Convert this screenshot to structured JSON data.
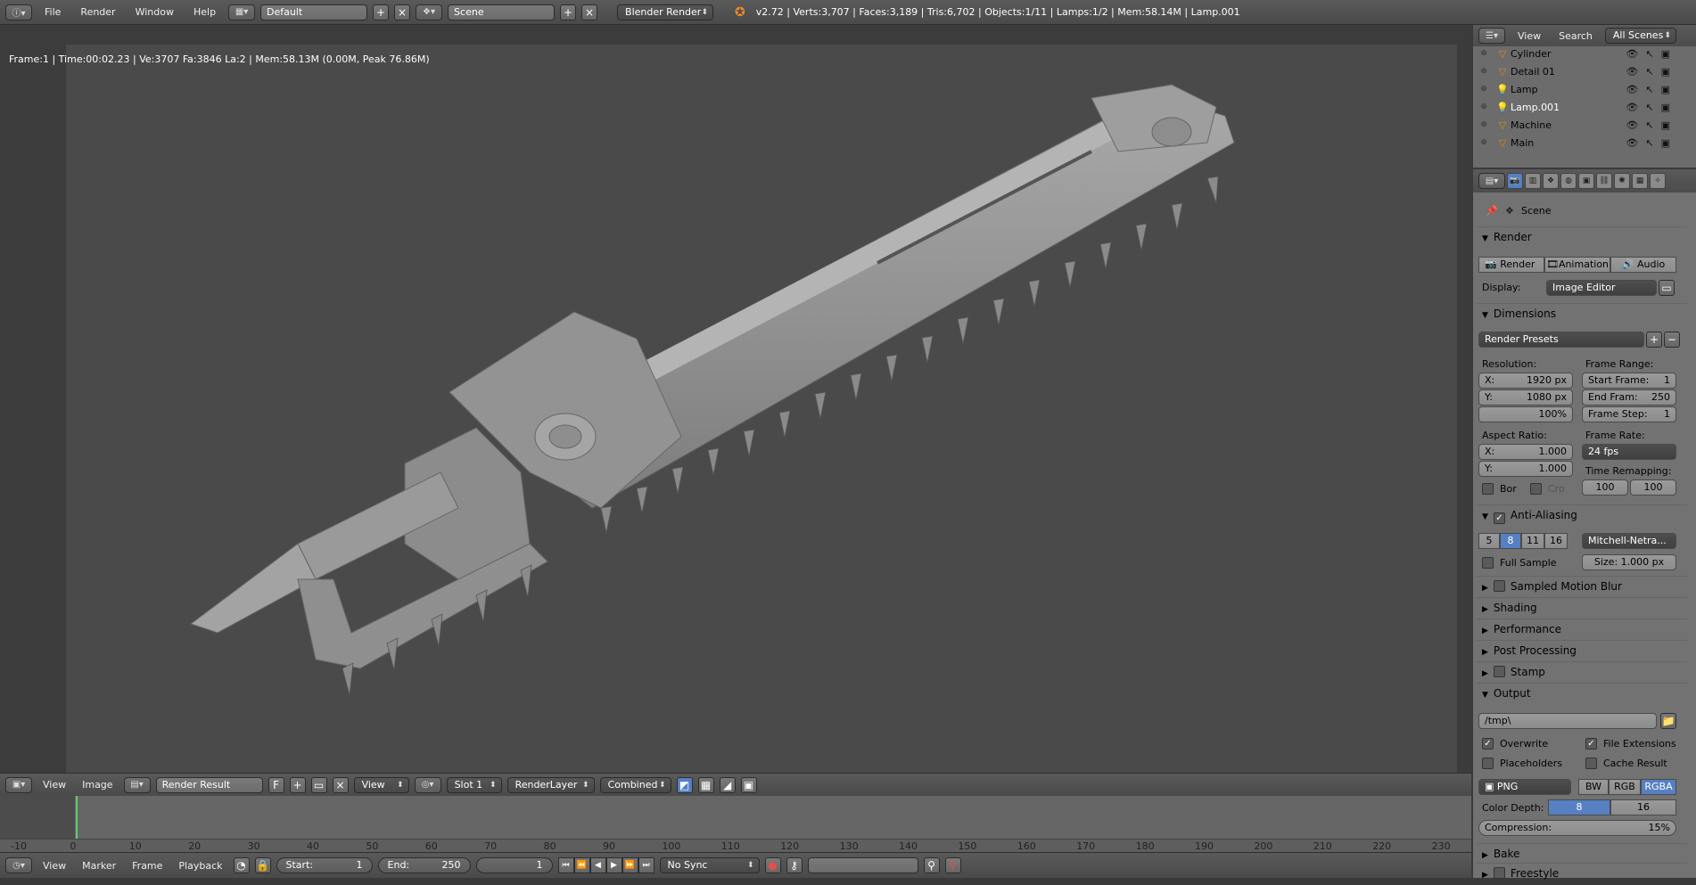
{
  "topbar": {
    "menus": [
      "File",
      "Render",
      "Window",
      "Help"
    ],
    "screen_layout": "Default",
    "scene": "Scene",
    "engine": "Blender Render",
    "stats": "v2.72 | Verts:3,707 | Faces:3,189 | Tris:6,702 | Objects:1/11 | Lamps:1/2 | Mem:58.14M | Lamp.001"
  },
  "viewport": {
    "info": "Frame:1 | Time:00:02.23 | Ve:3707 Fa:3846 La:2 | Mem:58.13M (0.00M, Peak 76.86M)"
  },
  "image_editor_header": {
    "menus": [
      "View",
      "Image"
    ],
    "image_name": "Render Result",
    "fake_user": "F",
    "view_label": "View",
    "slot": "Slot 1",
    "render_layer": "RenderLayer",
    "pass": "Combined"
  },
  "timeline": {
    "ticks": [
      "-10",
      "0",
      "10",
      "20",
      "30",
      "40",
      "50",
      "60",
      "70",
      "80",
      "90",
      "100",
      "110",
      "120",
      "130",
      "140",
      "150",
      "160",
      "170",
      "180",
      "190",
      "200",
      "210",
      "220",
      "230"
    ],
    "current_frame": 1
  },
  "bottombar": {
    "menus": [
      "View",
      "Marker",
      "Frame",
      "Playback"
    ],
    "start_label": "Start:",
    "start_value": "1",
    "end_label": "End:",
    "end_value": "250",
    "current": "1",
    "sync": "No Sync"
  },
  "outliner": {
    "header": [
      "View",
      "Search"
    ],
    "filter": "All Scenes",
    "objects": [
      {
        "name": "Cylinder",
        "icon": "mesh-icon"
      },
      {
        "name": "Detail 01",
        "icon": "mesh-icon"
      },
      {
        "name": "Lamp",
        "icon": "lamp-icon"
      },
      {
        "name": "Lamp.001",
        "icon": "lamp-icon"
      },
      {
        "name": "Machine",
        "icon": "mesh-icon"
      },
      {
        "name": "Main",
        "icon": "mesh-icon"
      }
    ]
  },
  "properties": {
    "context": "Scene",
    "render": {
      "title": "Render",
      "buttons": [
        "Render",
        "Animation",
        "Audio"
      ],
      "display_label": "Display:",
      "display_value": "Image Editor"
    },
    "dimensions": {
      "title": "Dimensions",
      "presets": "Render Presets",
      "resolution_label": "Resolution:",
      "res_x": "X:",
      "res_x_val": "1920 px",
      "res_y": "Y:",
      "res_y_val": "1080 px",
      "res_pct": "100%",
      "frame_range_label": "Frame Range:",
      "start_frame": "Start Frame:",
      "start_frame_val": "1",
      "end_frame": "End Fram:",
      "end_frame_val": "250",
      "frame_step": "Frame Step:",
      "frame_step_val": "1",
      "aspect_label": "Aspect Ratio:",
      "asp_x": "X:",
      "asp_x_val": "1.000",
      "asp_y": "Y:",
      "asp_y_val": "1.000",
      "frame_rate_label": "Frame Rate:",
      "frame_rate": "24 fps",
      "time_remap_label": "Time Remapping:",
      "remap_old": "100",
      "remap_new": "100",
      "border": "Bor",
      "crop": "Cro"
    },
    "aa": {
      "title": "Anti-Aliasing",
      "samples": [
        "5",
        "8",
        "11",
        "16"
      ],
      "filter": "Mitchell-Netra...",
      "full_sample": "Full Sample",
      "size": "Size: 1.000 px"
    },
    "collapsed": [
      "Sampled Motion Blur",
      "Shading",
      "Performance",
      "Post Processing",
      "Stamp"
    ],
    "output": {
      "title": "Output",
      "path": "/tmp\\",
      "overwrite": "Overwrite",
      "file_ext": "File Extensions",
      "placeholders": "Placeholders",
      "cache": "Cache Result",
      "format": "PNG",
      "modes": [
        "BW",
        "RGB",
        "RGBA"
      ],
      "depth_label": "Color Depth:",
      "depths": [
        "8",
        "16"
      ],
      "compression": "Compression:",
      "compression_val": "15%"
    },
    "bake": "Bake",
    "freestyle": "Freestyle"
  }
}
